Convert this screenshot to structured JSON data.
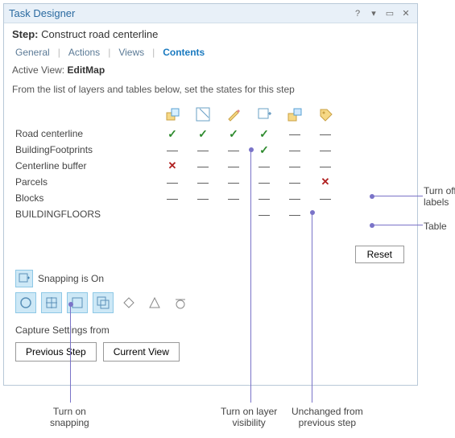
{
  "window": {
    "title": "Task Designer",
    "step_label": "Step:",
    "step_name": "Construct road centerline",
    "tabs": [
      "General",
      "Actions",
      "Views",
      "Contents"
    ],
    "active_tab": "Contents",
    "active_view_label": "Active View:",
    "active_view": "EditMap",
    "instruction": "From the list of layers and tables below, set the states for this step",
    "reset_label": "Reset",
    "snapping_label": "Snapping is On",
    "capture_label": "Capture Settings from",
    "capture_buttons": {
      "prev": "Previous Step",
      "current": "Current View"
    }
  },
  "column_icons": [
    "select-icon",
    "visibility-icon",
    "edit-icon",
    "snapping-col-icon",
    "label-icon",
    "tag-icon"
  ],
  "layers": [
    {
      "name": "Road centerline",
      "states": [
        "check",
        "check",
        "check",
        "check",
        "dash",
        "dash"
      ]
    },
    {
      "name": "BuildingFootprints",
      "states": [
        "dash",
        "dash",
        "dash",
        "check",
        "dash",
        "dash"
      ]
    },
    {
      "name": "Centerline buffer",
      "states": [
        "x",
        "dash",
        "dash",
        "dash",
        "dash",
        "dash"
      ]
    },
    {
      "name": "Parcels",
      "states": [
        "dash",
        "dash",
        "dash",
        "dash",
        "dash",
        "x"
      ]
    },
    {
      "name": "Blocks",
      "states": [
        "dash",
        "dash",
        "dash",
        "dash",
        "dash",
        "dash"
      ]
    },
    {
      "name": "BUILDINGFLOORS",
      "states": [
        "",
        "",
        "",
        "dash",
        "dash",
        ""
      ]
    }
  ],
  "snap_tools": [
    {
      "name": "point-snap",
      "selected": true
    },
    {
      "name": "end-snap",
      "selected": true
    },
    {
      "name": "vertex-snap",
      "selected": true
    },
    {
      "name": "edge-snap",
      "selected": true
    },
    {
      "name": "intersection-snap",
      "selected": false
    },
    {
      "name": "midpoint-snap",
      "selected": false
    },
    {
      "name": "tangent-snap",
      "selected": false
    }
  ],
  "callouts": {
    "turn_off_labels": "Turn off\nlabels",
    "table": "Table",
    "snapping": "Turn on\nsnapping",
    "visibility": "Turn on layer\nvisibility",
    "unchanged": "Unchanged from\nprevious step"
  }
}
